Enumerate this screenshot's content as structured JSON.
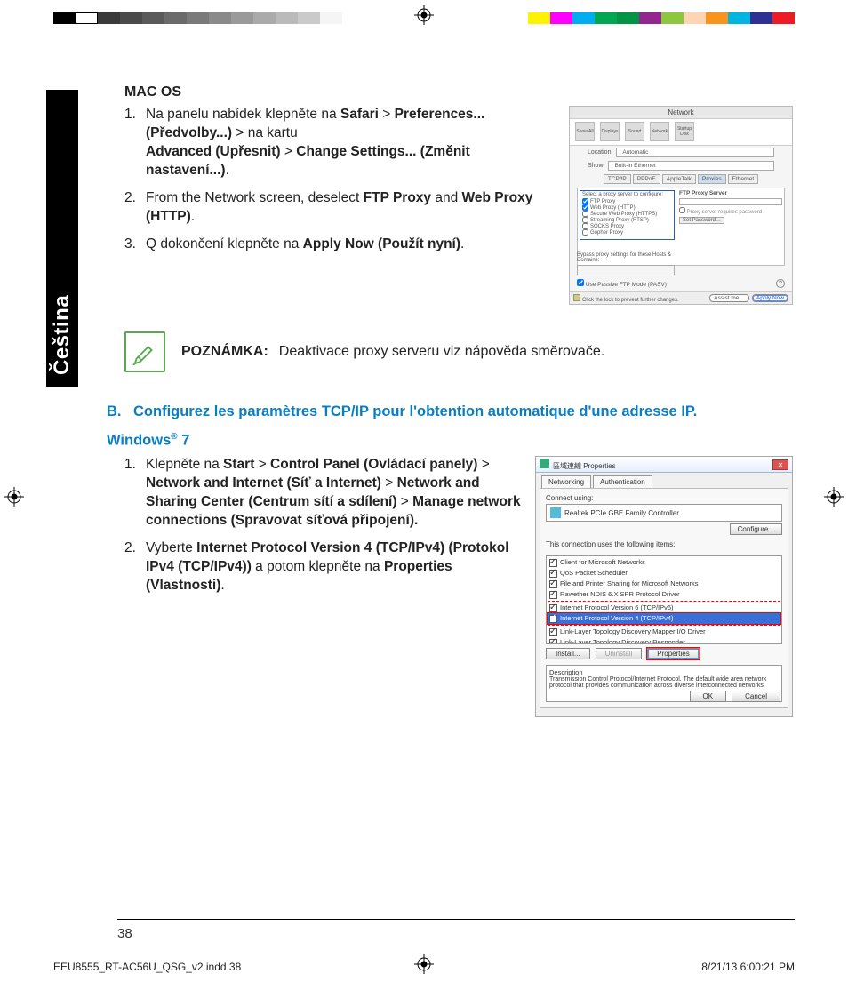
{
  "registration_swatches_left": [
    "#000000",
    "#ffffff",
    "#3a3a3a",
    "#4a4a4a",
    "#5a5a5a",
    "#6a6a6a",
    "#7a7a7a",
    "#8a8a8a",
    "#9a9a9a",
    "#aaaaaa",
    "#bababa",
    "#cacaca",
    "#f5f5f5"
  ],
  "registration_swatches_right": [
    "#fff200",
    "#ff00ff",
    "#00aeef",
    "#00a651",
    "#009444",
    "#92278f",
    "#8dc63f",
    "#fcd5b5",
    "#f7941d",
    "#00b5e2",
    "#2e3192",
    "#ed1c24"
  ],
  "lang_tab": "Čeština",
  "macos": {
    "heading": "MAC OS",
    "step1_prefix": "Na panelu nabídek klepněte na ",
    "step1_b1": "Safari",
    "step1_sep1": " > ",
    "step1_b2": "Preferences... (Předvolby...)",
    "step1_sep2": " > na kartu ",
    "step1_b3": "Advanced (Upřesnit)",
    "step1_sep3": " > ",
    "step1_b4": "Change Settings... (Změnit nastavení...)",
    "step1_suffix": ".",
    "step2_prefix": "From the Network screen, deselect ",
    "step2_b1": "FTP Proxy",
    "step2_mid": " and ",
    "step2_b2": "Web Proxy (HTTP)",
    "step2_suffix": ".",
    "step3_prefix": "Q dokončení klepněte na ",
    "step3_b1": "Apply Now (Použít nyní)",
    "step3_suffix": "."
  },
  "mac_shot": {
    "title": "Network",
    "toolbar": [
      "Show All",
      "Displays",
      "Sound",
      "Network",
      "Startup Disk"
    ],
    "location_lbl": "Location:",
    "location_val": "Automatic",
    "show_lbl": "Show:",
    "show_val": "Built-in Ethernet",
    "tabs": [
      "TCP/IP",
      "PPPoE",
      "AppleTalk",
      "Proxies",
      "Ethernet"
    ],
    "left_title": "Select a proxy server to configure:",
    "proxy_items": [
      "FTP Proxy",
      "Web Proxy (HTTP)",
      "Secure Web Proxy (HTTPS)",
      "Streaming Proxy (RTSP)",
      "SOCKS Proxy",
      "Gopher Proxy"
    ],
    "right_title": "FTP Proxy Server",
    "right_check": "Proxy server requires password",
    "set_pwd": "Set Password…",
    "bypass_lbl": "Bypass proxy settings for these Hosts & Domains:",
    "pasv": "Use Passive FTP Mode (PASV)",
    "lock_text": "Click the lock to prevent further changes.",
    "assist": "Assist me…",
    "apply": "Apply Now"
  },
  "note": {
    "label": "POZNÁMKA:",
    "text": "Deaktivace proxy serveru viz nápověda směrovače."
  },
  "section_b": {
    "letter": "B.",
    "title": "Configurez les paramètres TCP/IP pour l'obtention automatique d'une adresse IP."
  },
  "win7": {
    "heading_pre": "Windows",
    "heading_reg": "®",
    "heading_post": " 7",
    "step1_prefix": "Klepněte na ",
    "step1_b1": "Start",
    "s1": " > ",
    "step1_b2": "Control Panel (Ovládací panely)",
    "step1_b3": "Network and Internet (Síť a Internet)",
    "step1_b4": "Network and Sharing Center (Centrum sítí a sdílení)",
    "step1_b5": "Manage network connections (Spravovat síťová připojení).",
    "step2_prefix": "Vyberte ",
    "step2_b1": "Internet Protocol Version 4 (TCP/IPv4) (Protokol IPv4 (TCP/IPv4))",
    "step2_mid": " a potom klepněte na ",
    "step2_b2": "Properties (Vlastnosti)",
    "step2_suffix": "."
  },
  "win_shot": {
    "title": "區域連線 Properties",
    "tabs": [
      "Networking",
      "Authentication"
    ],
    "connect_using": "Connect using:",
    "adapter": "Realtek PCIe GBE Family Controller",
    "configure": "Configure...",
    "uses_items_lbl": "This connection uses the following items:",
    "items": [
      "Client for Microsoft Networks",
      "QoS Packet Scheduler",
      "File and Printer Sharing for Microsoft Networks",
      "Rawether NDIS 6.X SPR Protocol Driver",
      "Internet Protocol Version 6 (TCP/IPv6)",
      "Internet Protocol Version 4 (TCP/IPv4)",
      "Link-Layer Topology Discovery Mapper I/O Driver",
      "Link-Layer Topology Discovery Responder"
    ],
    "install": "Install...",
    "uninstall": "Uninstall",
    "properties": "Properties",
    "desc_lbl": "Description",
    "desc": "Transmission Control Protocol/Internet Protocol. The default wide area network protocol that provides communication across diverse interconnected networks.",
    "ok": "OK",
    "cancel": "Cancel"
  },
  "page_number": "38",
  "footer": {
    "left": "EEU8555_RT-AC56U_QSG_v2.indd   38",
    "right": "8/21/13   6:00:21 PM"
  }
}
